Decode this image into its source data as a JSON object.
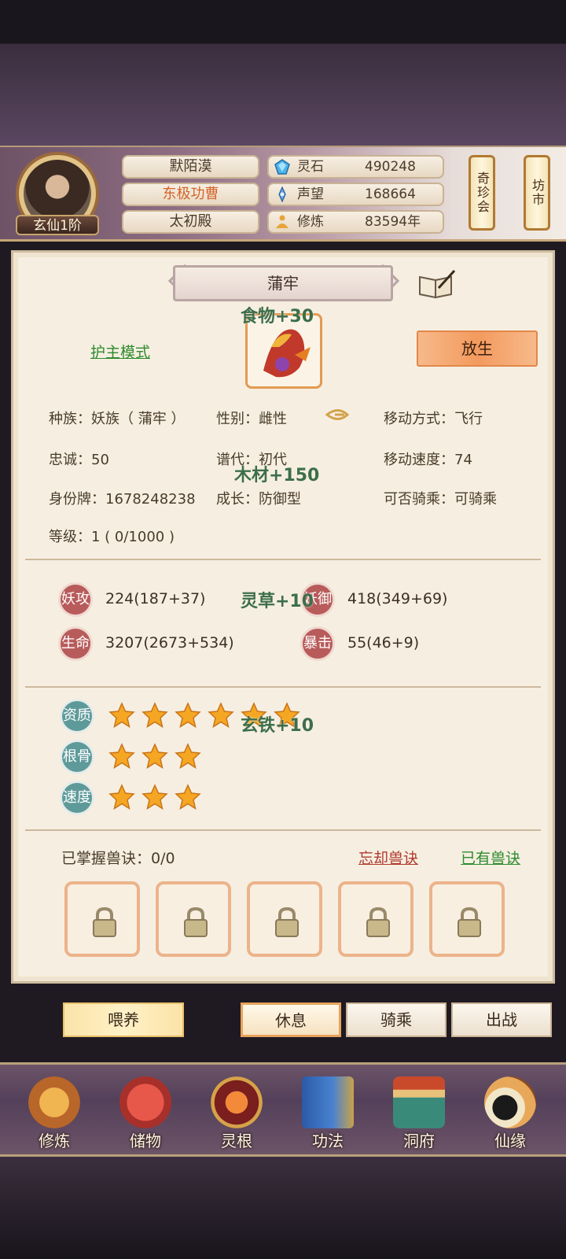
{
  "header": {
    "realm": "玄仙1阶",
    "player_name": "默陌漠",
    "title": "东极功曹",
    "sect": "太初殿",
    "resources": [
      {
        "icon": "spirit-stone-icon",
        "label": "灵石",
        "value": "490248"
      },
      {
        "icon": "prestige-icon",
        "label": "声望",
        "value": "168664"
      },
      {
        "icon": "cultivation-icon",
        "label": "修炼",
        "value": "83594年"
      }
    ],
    "shop_buttons": [
      "奇珍会",
      "坊市"
    ]
  },
  "pet": {
    "name": "蒲牢",
    "guard_mode": "护主模式",
    "release": "放生",
    "attributes": {
      "race": "种族：妖族（ 蒲牢 ）",
      "gender": "性别：雌性",
      "move_type": "移动方式：飞行",
      "loyalty": "忠诚：50",
      "generation": "谱代：初代",
      "move_speed": "移动速度：74",
      "id_tag": "身份牌：1678248238",
      "growth": "成长：防御型",
      "rideable": "可否骑乘：可骑乘",
      "level": "等级：1 ( 0/1000 )"
    },
    "stats": [
      {
        "label": "妖攻",
        "value": "224(187+37)"
      },
      {
        "label": "妖御",
        "value": "418(349+69)"
      },
      {
        "label": "生命",
        "value": "3207(2673+534)"
      },
      {
        "label": "暴击",
        "value": "55(46+9)"
      }
    ],
    "talents": [
      {
        "label": "资质",
        "stars": 6
      },
      {
        "label": "根骨",
        "stars": 3
      },
      {
        "label": "速度",
        "stars": 3
      }
    ],
    "skills": {
      "mastered": "已掌握兽诀：0/0",
      "forget": "忘却兽诀",
      "owned": "已有兽诀"
    }
  },
  "floating_rewards": [
    "食物+30",
    "木材+150",
    "灵草+10",
    "玄铁+10"
  ],
  "actions": [
    "喂养",
    "休息",
    "骑乘",
    "出战"
  ],
  "nav": [
    {
      "label": "修炼",
      "icon": "cultivate-icon"
    },
    {
      "label": "储物",
      "icon": "storage-bag-icon"
    },
    {
      "label": "灵根",
      "icon": "spirit-root-icon"
    },
    {
      "label": "功法",
      "icon": "technique-book-icon"
    },
    {
      "label": "洞府",
      "icon": "cave-dwelling-icon"
    },
    {
      "label": "仙缘",
      "icon": "immortal-fate-icon"
    }
  ],
  "colors": {
    "accent_orange": "#f39a5e",
    "link_green": "#2e8b2e",
    "link_red": "#b03a2e",
    "float_green": "#3d6e4c",
    "panel_bg": "#f6efe1"
  }
}
